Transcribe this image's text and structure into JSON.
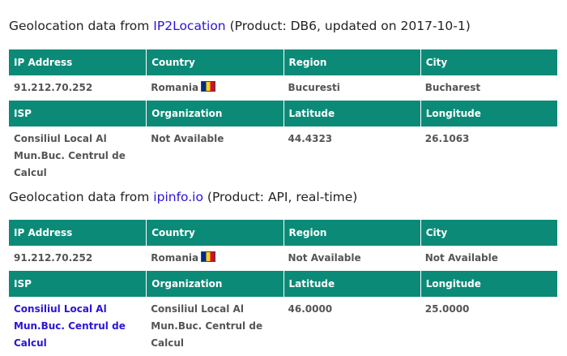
{
  "section1": {
    "title_prefix": "Geolocation data from ",
    "source_link": "IP2Location",
    "title_suffix": " (Product: DB6, updated on 2017-10-1)",
    "headers_row1": [
      "IP Address",
      "Country",
      "Region",
      "City"
    ],
    "values_row1": {
      "ip": "91.212.70.252",
      "country": "Romania",
      "region": "Bucuresti",
      "city": "Bucharest"
    },
    "headers_row2": [
      "ISP",
      "Organization",
      "Latitude",
      "Longitude"
    ],
    "values_row2": {
      "isp": "Consiliul Local Al Mun.Buc. Centrul de Calcul",
      "organization": "Not Available",
      "latitude": "44.4323",
      "longitude": "26.1063"
    }
  },
  "section2": {
    "title_prefix": "Geolocation data from ",
    "source_link": "ipinfo.io",
    "title_suffix": " (Product: API, real-time)",
    "headers_row1": [
      "IP Address",
      "Country",
      "Region",
      "City"
    ],
    "values_row1": {
      "ip": "91.212.70.252",
      "country": "Romania",
      "region": "Not Available",
      "city": "Not Available"
    },
    "headers_row2": [
      "ISP",
      "Organization",
      "Latitude",
      "Longitude"
    ],
    "values_row2": {
      "isp": "Consiliul Local Al Mun.Buc. Centrul de Calcul",
      "organization": "Consiliul Local Al Mun.Buc. Centrul de Calcul",
      "latitude": "46.0000",
      "longitude": "25.0000"
    }
  },
  "colors": {
    "header_bg": "#0c8a78",
    "link": "#2a14d9",
    "value_text": "#555555"
  },
  "icons": {
    "country_flag": "romania-flag-icon"
  }
}
